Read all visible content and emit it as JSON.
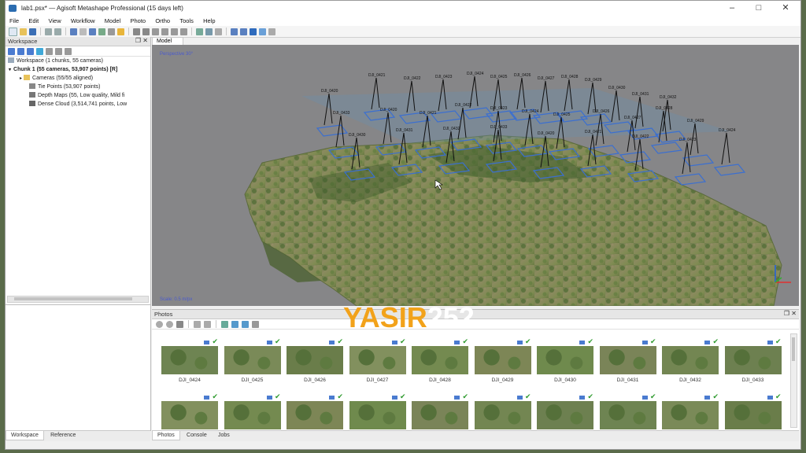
{
  "window": {
    "title": "lab1.psx* — Agisoft Metashape Professional (15 days left)"
  },
  "menu": [
    "File",
    "Edit",
    "View",
    "Workflow",
    "Model",
    "Photo",
    "Ortho",
    "Tools",
    "Help"
  ],
  "workspace": {
    "title": "Workspace",
    "items": [
      {
        "label": "Workspace (1 chunks, 55 cameras)",
        "bold": false
      },
      {
        "label": "Chunk 1 (55 cameras, 53,907 points) [R]",
        "bold": true
      },
      {
        "label": "Cameras (55/55 aligned)",
        "bold": false
      },
      {
        "label": "Tie Points (53,907 points)",
        "bold": false
      },
      {
        "label": "Depth Maps (55, Low quality, Mild fi",
        "bold": false
      },
      {
        "label": "Dense Cloud (3,514,741 points, Low",
        "bold": false
      }
    ]
  },
  "left_tabs": [
    "Workspace",
    "Reference"
  ],
  "model": {
    "tab_label": "Model",
    "perspective_label": "Perspective 30°",
    "scale_label": "Scale: 0.5 m/px"
  },
  "cameras_in_view": [
    "DJI_0420",
    "DJI_0421",
    "DJI_0422",
    "DJI_0423",
    "DJI_0424",
    "DJI_0425",
    "DJI_0426",
    "DJI_0427",
    "DJI_0428",
    "DJI_0429",
    "DJI_0430",
    "DJI_0431",
    "DJI_0432",
    "DJI_0433"
  ],
  "photos": {
    "title": "Photos",
    "row1_labels": [
      "DJI_0424",
      "DJI_0425",
      "DJI_0426",
      "DJI_0427",
      "DJI_0428",
      "DJI_0429",
      "DJI_0430",
      "DJI_0431",
      "DJI_0432",
      "DJI_0433"
    ],
    "row2_labels": [
      "",
      "",
      "",
      "",
      "",
      "",
      "",
      "",
      "",
      ""
    ]
  },
  "bottom_tabs": [
    "Photos",
    "Console",
    "Jobs"
  ],
  "watermark": {
    "part1": "YASIR",
    "part2": "252"
  },
  "colors": {
    "accent": "#f2a21a",
    "camera_plane": "#4a7bd0",
    "check": "#2e9a2e",
    "viewport_bg": "#868688"
  }
}
